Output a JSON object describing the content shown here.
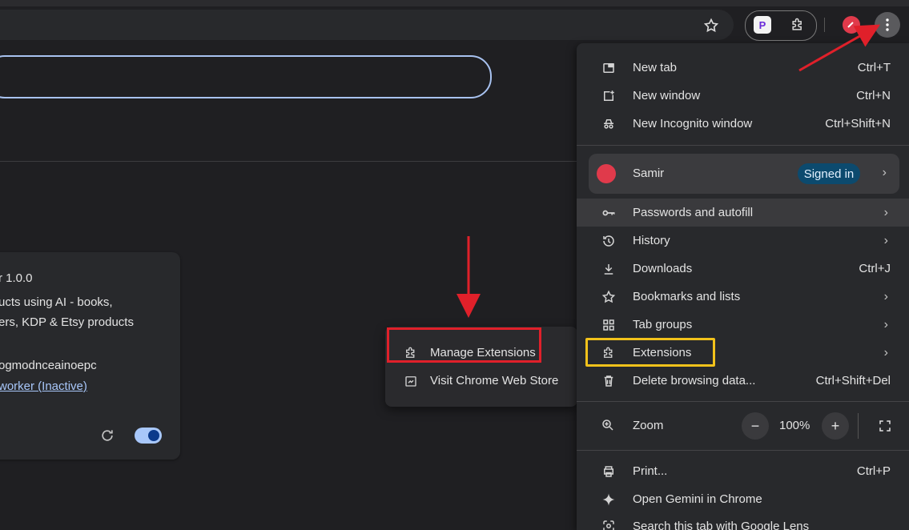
{
  "menu": {
    "new_tab": {
      "label": "New tab",
      "shortcut": "Ctrl+T"
    },
    "new_window": {
      "label": "New window",
      "shortcut": "Ctrl+N"
    },
    "new_incognito": {
      "label": "New Incognito window",
      "shortcut": "Ctrl+Shift+N"
    },
    "profile": {
      "name": "Samir",
      "status": "Signed in"
    },
    "passwords": {
      "label": "Passwords and autofill"
    },
    "history": {
      "label": "History"
    },
    "downloads": {
      "label": "Downloads",
      "shortcut": "Ctrl+J"
    },
    "bookmarks": {
      "label": "Bookmarks and lists"
    },
    "tab_groups": {
      "label": "Tab groups"
    },
    "extensions": {
      "label": "Extensions"
    },
    "delete_data": {
      "label": "Delete browsing data...",
      "shortcut": "Ctrl+Shift+Del"
    },
    "zoom": {
      "label": "Zoom",
      "value": "100%",
      "minus": "−",
      "plus": "+"
    },
    "print": {
      "label": "Print...",
      "shortcut": "Ctrl+P"
    },
    "gemini": {
      "label": "Open Gemini in Chrome"
    },
    "lens": {
      "label": "Search this tab with Google Lens"
    }
  },
  "submenu": {
    "manage": "Manage Extensions",
    "store": "Visit Chrome Web Store"
  },
  "card": {
    "version_line": "r  1.0.0",
    "desc_line1": "ucts using AI - books,",
    "desc_line2": "ers, KDP & Etsy products",
    "id_line": "ogmodnceainoepc",
    "worker_link": "worker (Inactive)"
  },
  "toolbar": {
    "pdf_badge": "P"
  },
  "icons": {
    "star": "star-icon",
    "puzzle": "puzzle-icon",
    "kebab": "kebab-icon"
  },
  "colors": {
    "highlight_red": "#e0202a",
    "highlight_yellow": "#f2c21b",
    "signed_in_badge": "#0c4a6e"
  }
}
